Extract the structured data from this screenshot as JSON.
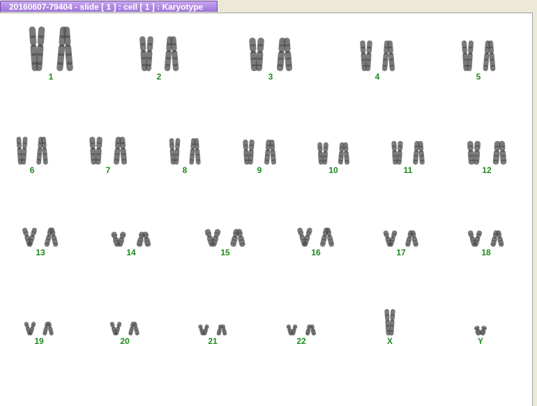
{
  "tab": {
    "title": "20160607-79404 - slide [ 1 ] : cell [ 1 ] : Karyotype"
  },
  "colors": {
    "label": "#1a8a1a",
    "tab_bg": "#a27ddc",
    "tab_text": "#ffffff",
    "chromosome": "#555555"
  },
  "chromosomes": [
    {
      "label": "1"
    },
    {
      "label": "2"
    },
    {
      "label": "3"
    },
    {
      "label": "4"
    },
    {
      "label": "5"
    },
    {
      "label": "6"
    },
    {
      "label": "7"
    },
    {
      "label": "8"
    },
    {
      "label": "9"
    },
    {
      "label": "10"
    },
    {
      "label": "11"
    },
    {
      "label": "12"
    },
    {
      "label": "13"
    },
    {
      "label": "14"
    },
    {
      "label": "15"
    },
    {
      "label": "16"
    },
    {
      "label": "17"
    },
    {
      "label": "18"
    },
    {
      "label": "19"
    },
    {
      "label": "20"
    },
    {
      "label": "21"
    },
    {
      "label": "22"
    },
    {
      "label": "X"
    },
    {
      "label": "Y"
    }
  ]
}
